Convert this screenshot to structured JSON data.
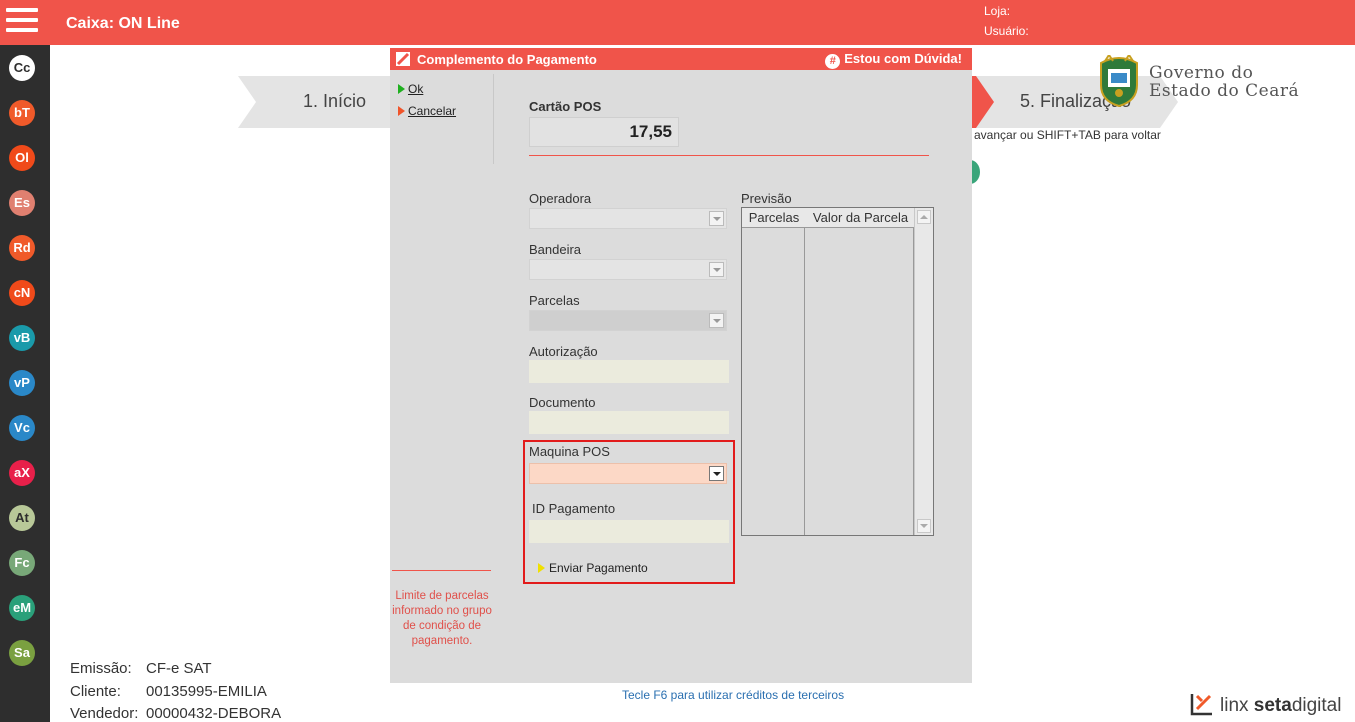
{
  "header": {
    "title": "Caixa: ON Line",
    "loja_label": "Loja:",
    "usuario_label": "Usuário:"
  },
  "sidebar": {
    "items": [
      {
        "code": "Cc",
        "color": "#ffffff",
        "text_color": "#2e2e2e"
      },
      {
        "code": "bT",
        "color": "#f05a2a"
      },
      {
        "code": "Ol",
        "color": "#f04a1a"
      },
      {
        "code": "Es",
        "color": "#e08070"
      },
      {
        "code": "Rd",
        "color": "#f05a2a"
      },
      {
        "code": "cN",
        "color": "#f04a1a"
      },
      {
        "code": "vB",
        "color": "#1a9aaa"
      },
      {
        "code": "vP",
        "color": "#2a88c8"
      },
      {
        "code": "Vc",
        "color": "#2a88c8"
      },
      {
        "code": "aX",
        "color": "#e8204a"
      },
      {
        "code": "At",
        "color": "#b8c898",
        "text_color": "#2e2e2e"
      },
      {
        "code": "Fc",
        "color": "#78a878"
      },
      {
        "code": "eM",
        "color": "#2aa07a"
      },
      {
        "code": "Sa",
        "color": "#7aa040"
      }
    ]
  },
  "steps": {
    "step1": "1. Início",
    "step5": "5. Finalização",
    "hint": "a avançar ou SHIFT+TAB para voltar"
  },
  "gov_logo": {
    "line1": "Governo do",
    "line2": "Estado do Ceará"
  },
  "info": {
    "emissao_label": "Emissão:",
    "emissao_value": "CF-e SAT",
    "cliente_label": "Cliente:",
    "cliente_value": "00135995-EMILIA",
    "vendedor_label": "Vendedor:",
    "vendedor_value": "00000432-DEBORA"
  },
  "f6_hint": "Tecle F6 para utilizar créditos de terceiros",
  "linx": {
    "brand1": "linx",
    "brand2": "seta",
    "brand3": "digital"
  },
  "modal": {
    "title": "Complemento do Pagamento",
    "help_label": "Estou com Dúvida!",
    "menu": {
      "ok": "Ok",
      "cancel": "Cancelar"
    },
    "note": "Limite de parcelas informado no grupo de condição de pagamento.",
    "payment_type": "Cartão POS",
    "total": "17,55",
    "fields": {
      "operadora": "Operadora",
      "bandeira": "Bandeira",
      "parcelas": "Parcelas",
      "autorizacao": "Autorização",
      "documento": "Documento",
      "maquina_pos": "Maquina POS",
      "id_pagamento": "ID Pagamento"
    },
    "send_button": "Enviar Pagamento",
    "preview": {
      "label": "Previsão",
      "columns": [
        "Parcelas",
        "Valor da Parcela"
      ]
    }
  }
}
